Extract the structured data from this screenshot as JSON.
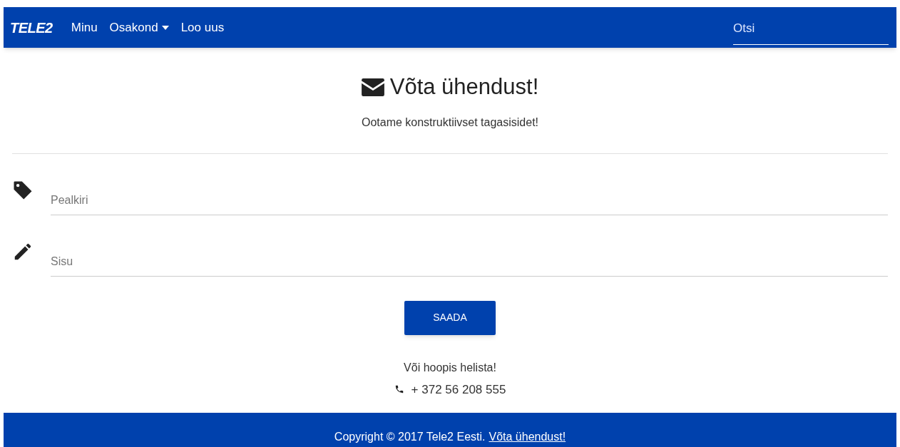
{
  "navbar": {
    "brand": "TELE2",
    "items": [
      {
        "label": "Minu",
        "kind": "link"
      },
      {
        "label": "Osakond",
        "kind": "dropdown"
      },
      {
        "label": "Loo uus",
        "kind": "link"
      }
    ],
    "search": {
      "placeholder": "Otsi"
    }
  },
  "header": {
    "title": "Võta ühendust!",
    "subtitle": "Ootame konstruktiivset tagasisidet!"
  },
  "form": {
    "fields": [
      {
        "kind": "tag",
        "placeholder": "Pealkiri"
      },
      {
        "kind": "pencil",
        "placeholder": "Sisu"
      }
    ],
    "submit": "SAADA"
  },
  "call": {
    "text": "Või hoopis helista!",
    "phone": "+ 372 56 208 555"
  },
  "footer": {
    "text": "Copyright © 2017 Tele2 Eesti.",
    "link": "Võta ühendust!"
  }
}
